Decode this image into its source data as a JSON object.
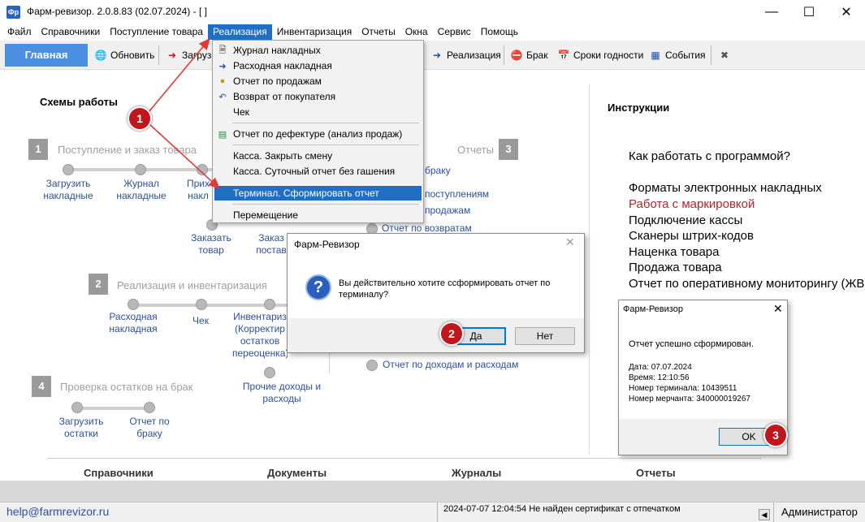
{
  "window": {
    "title": "Фарм-ревизор. 2.0.8.83 (02.07.2024) - [ ]",
    "icon_text": "Фр",
    "controls": [
      "minimize-icon",
      "maximize-icon",
      "close-icon"
    ]
  },
  "menubar": {
    "items": [
      "Файл",
      "Справочники",
      "Поступление товара",
      "Реализация",
      "Инвентаризация",
      "Отчеты",
      "Окна",
      "Сервис",
      "Помощь"
    ],
    "active": "Реализация"
  },
  "toolbar": {
    "main_tab": "Главная",
    "refresh": "Обновить",
    "load": "Загрузи",
    "sales": "Реализация",
    "defect": "Брак",
    "expiry": "Сроки годности",
    "events": "События"
  },
  "dropdown": {
    "items": [
      "Журнал накладных",
      "Расходная накладная",
      "Отчет по продажам",
      "Возврат от покупателя",
      "Чек",
      "Отчет по дефектуре (анализ продаж)",
      "Касса. Закрыть смену",
      "Касса. Суточный отчет без гашения",
      "Терминал. Сформировать отчет",
      "Перемещение"
    ],
    "selected": "Терминал. Сформировать отчет"
  },
  "schemes": {
    "title": "Схемы работы",
    "s1": {
      "num": "1",
      "title": "Поступление и заказ товара",
      "links": [
        "Загрузить накладные",
        "Журнал накладные",
        "Прих накл",
        "Заказать товар",
        "Заказ постав"
      ]
    },
    "s2": {
      "num": "2",
      "title": "Реализация и инвентаризация",
      "links": [
        "Расходная накладная",
        "Чек",
        "Инвентариз (Корректир остатков переоценка)",
        "Прочие доходы и расходы"
      ]
    },
    "s3": {
      "num": "3",
      "title": "Отчеты",
      "links": [
        "браку",
        "поступлениям",
        "продажам",
        "Отчет по возвратам",
        "Отчет по доходам и расходам"
      ]
    },
    "s4": {
      "num": "4",
      "title": "Проверка остатков на брак",
      "links": [
        "Загрузить остатки",
        "Отчет по браку"
      ]
    }
  },
  "instructions": {
    "title": "Инструкции",
    "items": [
      "Как работать с программой?",
      "Форматы электронных накладных",
      "Работа с маркировкой",
      "Подключение кассы",
      "Сканеры штрих-кодов",
      "Наценка товара",
      "Продажа товара",
      "Отчет по оперативному мониторингу (ЖВ)"
    ]
  },
  "bottom": {
    "headers": [
      "Справочники",
      "Документы",
      "Журналы",
      "Отчеты"
    ]
  },
  "statusbar": {
    "email": "help@farmrevizor.ru",
    "message": "2024-07-07 12:04:54 Не найден сертификат с отпечатком",
    "user": "Администратор"
  },
  "dialog_confirm": {
    "title": "Фарм-Ревизор",
    "text_line1": "Вы действительно хотите ссформировать отчет по",
    "text_line2": "терминалу?",
    "yes": "Да",
    "no": "Нет"
  },
  "dialog_result": {
    "title": "Фарм-Ревизор",
    "heading": "Отчет успешно сформирован.",
    "date": "Дата: 07.07.2024",
    "time": "Время: 12:10:56",
    "terminal": "Номер терминала: 10439511",
    "merchant": "Номер мерчанта: 340000019267",
    "ok": "OK"
  },
  "badges": [
    "1",
    "2",
    "3"
  ],
  "colors": {
    "accent": "#1f6fc6",
    "main_tab": "#4a8fe0",
    "badge": "#c0161c",
    "annotation_arrow": "#e03a3a",
    "link": "#2b4fa0",
    "instruction_highlight": "#b0262c"
  }
}
